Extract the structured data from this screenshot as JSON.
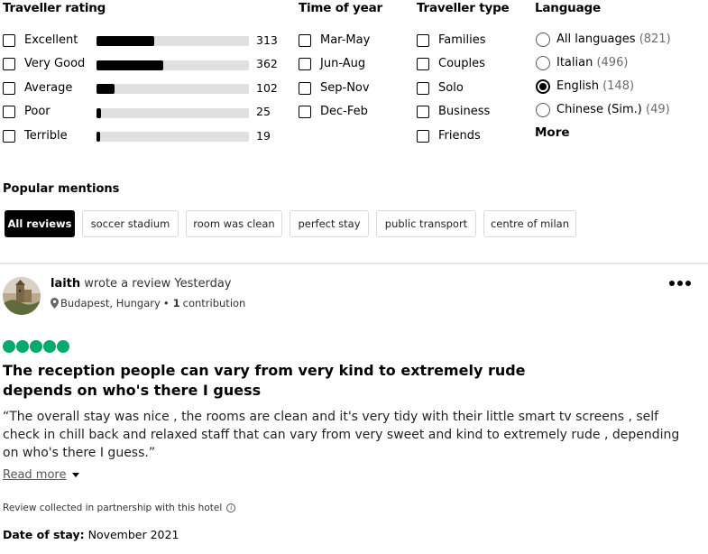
{
  "filters": {
    "rating": {
      "title": "Traveller rating",
      "items": [
        {
          "label": "Excellent",
          "count": "313",
          "fraction": 0.38
        },
        {
          "label": "Very Good",
          "count": "362",
          "fraction": 0.44
        },
        {
          "label": "Average",
          "count": "102",
          "fraction": 0.12
        },
        {
          "label": "Poor",
          "count": "25",
          "fraction": 0.03
        },
        {
          "label": "Terrible",
          "count": "19",
          "fraction": 0.02
        }
      ]
    },
    "time_of_year": {
      "title": "Time of year",
      "items": [
        {
          "label": "Mar-May"
        },
        {
          "label": "Jun-Aug"
        },
        {
          "label": "Sep-Nov"
        },
        {
          "label": "Dec-Feb"
        }
      ]
    },
    "traveller_type": {
      "title": "Traveller type",
      "items": [
        {
          "label": "Families"
        },
        {
          "label": "Couples"
        },
        {
          "label": "Solo"
        },
        {
          "label": "Business"
        },
        {
          "label": "Friends"
        }
      ]
    },
    "language": {
      "title": "Language",
      "items": [
        {
          "label": "All languages",
          "count": "(821)",
          "selected": false
        },
        {
          "label": "Italian",
          "count": "(496)",
          "selected": false
        },
        {
          "label": "English",
          "count": "(148)",
          "selected": true
        },
        {
          "label": "Chinese (Sim.)",
          "count": "(49)",
          "selected": false
        }
      ],
      "more_label": "More"
    }
  },
  "popular_mentions": {
    "title": "Popular mentions",
    "chips": [
      "All reviews",
      "soccer stadium",
      "room was clean",
      "perfect stay",
      "public transport",
      "centre of milan"
    ]
  },
  "review": {
    "author": "laith",
    "byline_rest": "wrote a review Yesterday",
    "location": "Budapest, Hungary",
    "separator": "•",
    "contributions_num": "1",
    "contributions_label": "contribution",
    "rating_bubbles": 5,
    "title": "The reception people can vary from very kind to extremely rude depends on who's there I guess",
    "body": "“The overall stay was nice , the rooms are clean and it's very tidy with their little smart tv screens , self check in chill back and relaxed staff that can vary from very sweet and kind to extremely rude , depending on who's there I guess.”",
    "read_more": "Read more",
    "partnership": "Review collected in partnership with this hotel",
    "info_glyph": "i",
    "date_label": "Date of stay:",
    "date_value": "November 2021"
  },
  "colors": {
    "bubble": "#00aa6c",
    "bar_fill": "#000000",
    "bar_track": "#e0e0e0",
    "chip_active": "#000000"
  },
  "icons": [
    "location-pin-icon",
    "more-options-icon",
    "info-icon",
    "chevron-down-icon"
  ]
}
